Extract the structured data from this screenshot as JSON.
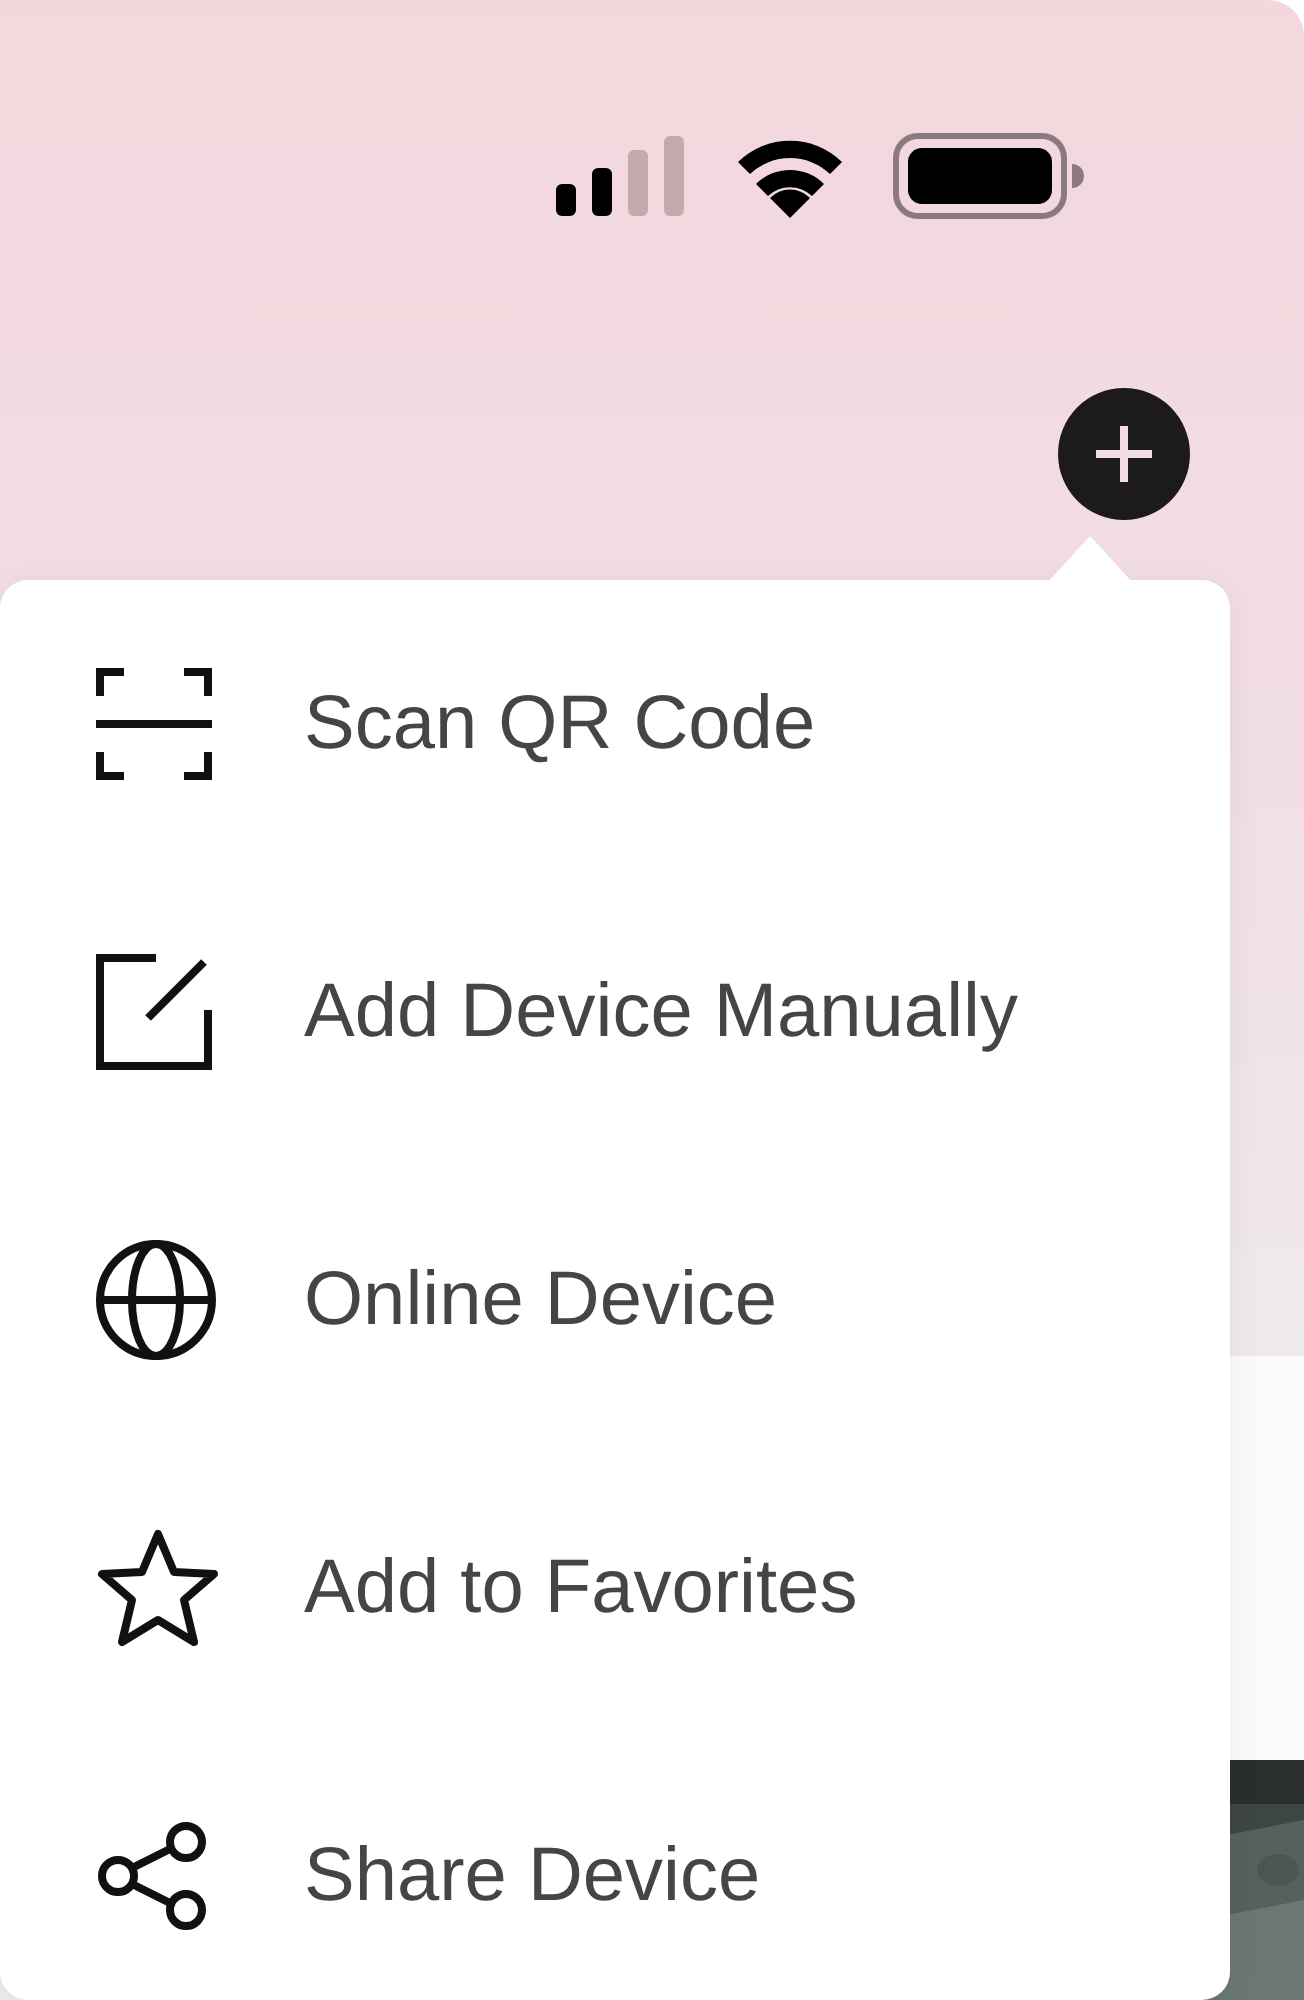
{
  "menu": {
    "items": [
      {
        "kind": "scan",
        "label": "Scan QR Code"
      },
      {
        "kind": "edit",
        "label": "Add Device Manually"
      },
      {
        "kind": "globe",
        "label": "Online Device"
      },
      {
        "kind": "star",
        "label": "Add to Favorites"
      },
      {
        "kind": "share",
        "label": "Share Device"
      }
    ]
  }
}
